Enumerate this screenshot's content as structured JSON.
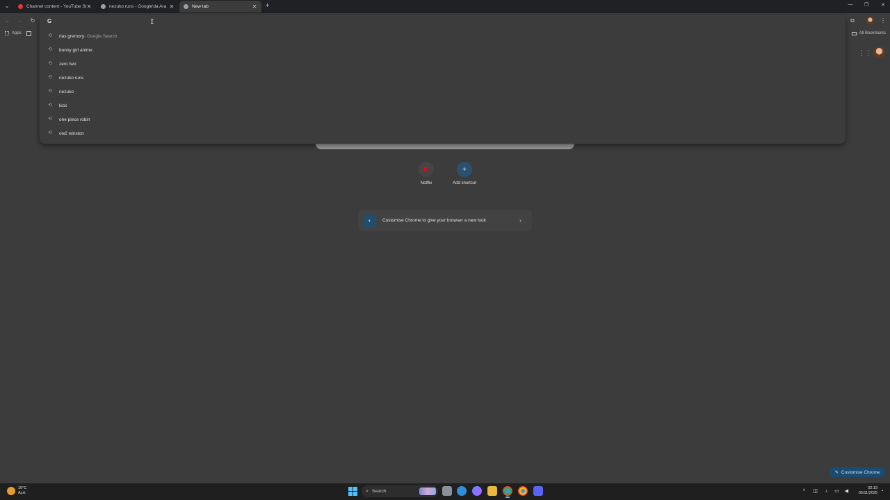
{
  "tabs": [
    {
      "title": "Channel content - YouTube Studio",
      "favicon_color": "#e53935",
      "active": false
    },
    {
      "title": "nezuko runs - Google'da Ara",
      "favicon_color": "#9aa0a6",
      "active": false
    },
    {
      "title": "New tab",
      "favicon_color": "#9aa0a6",
      "active": true
    }
  ],
  "bookmarks": {
    "apps_label": "Apps",
    "all_bookmarks_label": "All Bookmarks"
  },
  "omnibox": {
    "value": "",
    "google_glyph": "G"
  },
  "suggestions": [
    {
      "text": "rias gremory",
      "suffix": " - Google Search"
    },
    {
      "text": "bunny girl anime",
      "suffix": ""
    },
    {
      "text": "zero two",
      "suffix": ""
    },
    {
      "text": "nezuko runs",
      "suffix": ""
    },
    {
      "text": "nezuko",
      "suffix": ""
    },
    {
      "text": "kick",
      "suffix": ""
    },
    {
      "text": "one piece robin",
      "suffix": ""
    },
    {
      "text": "ow2 winston",
      "suffix": ""
    }
  ],
  "shortcuts": [
    {
      "label": "Netflix",
      "glyph": "N"
    },
    {
      "label": "Add shortcut",
      "glyph": "+"
    }
  ],
  "customise_card": {
    "label": "Customise Chrome to give your browser a new look"
  },
  "customise_button": {
    "label": "Customise Chrome"
  },
  "taskbar": {
    "weather_temp": "10°C",
    "weather_desc": "Açık",
    "search_label": "Search",
    "time": "02:19",
    "date": "05/11/2025"
  },
  "colors": {
    "accent": "#a8c7fa",
    "taskbar_accent": "#4cc2ff",
    "netflix": "#e50914"
  }
}
